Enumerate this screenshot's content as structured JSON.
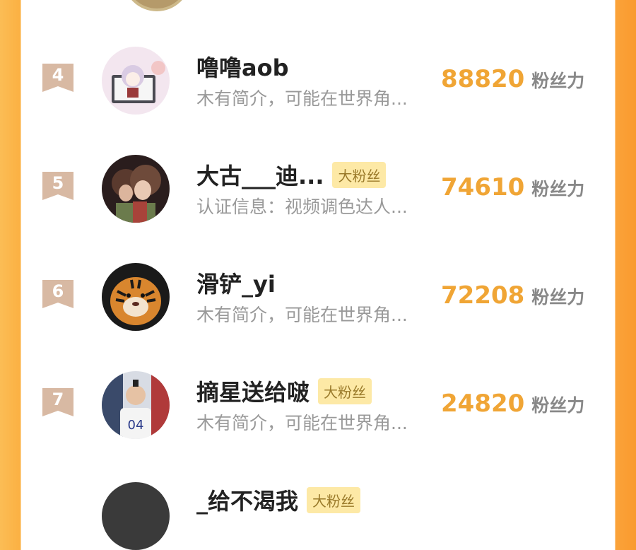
{
  "ranking": [
    {
      "rank": "4",
      "name": "噜噜aob",
      "badge": "",
      "desc": "木有简介，可能在世界角...",
      "score": "88820",
      "unit": "粉丝力",
      "avatar": "avatar-anime-girl"
    },
    {
      "rank": "5",
      "name": "大古___迪...",
      "badge": "大粉丝",
      "desc": "认证信息：视频调色达人...",
      "score": "74610",
      "unit": "粉丝力",
      "avatar": "avatar-anime-couple"
    },
    {
      "rank": "6",
      "name": "滑铲_yi",
      "badge": "",
      "desc": "木有简介，可能在世界角...",
      "score": "72208",
      "unit": "粉丝力",
      "avatar": "avatar-tiger"
    },
    {
      "rank": "7",
      "name": "摘星送给啵",
      "badge": "大粉丝",
      "desc": "木有简介，可能在世界角...",
      "score": "24820",
      "unit": "粉丝力",
      "avatar": "avatar-people-photo"
    }
  ],
  "partial_next": {
    "name": "_给不渴我",
    "badge": "大粉丝"
  },
  "colors": {
    "accent": "#f0a535",
    "badge_bg": "#fde9a6",
    "rank_flag": "#d8b9a3"
  }
}
